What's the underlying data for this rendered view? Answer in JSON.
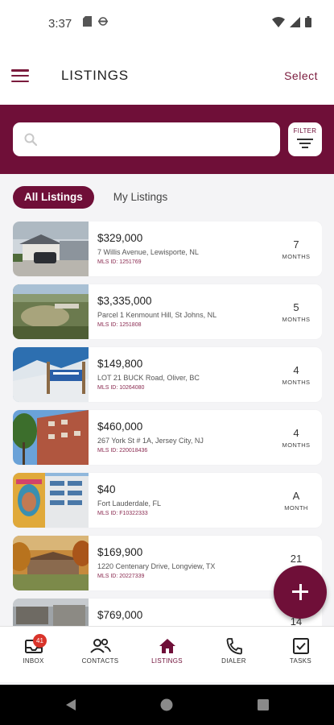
{
  "status_bar": {
    "time": "3:37"
  },
  "header": {
    "title": "LISTINGS",
    "select_label": "Select"
  },
  "search": {
    "placeholder": "",
    "value": "",
    "filter_label": "FILTER"
  },
  "tabs": [
    {
      "label": "All Listings",
      "active": true
    },
    {
      "label": "My Listings",
      "active": false
    }
  ],
  "listings": [
    {
      "price": "$329,000",
      "address": "7 Willis Avenue, Lewisporte, NL",
      "mls": "MLS ID: 1251769",
      "age_value": "7",
      "age_unit": "MONTHS"
    },
    {
      "price": "$3,335,000",
      "address": "Parcel 1 Kenmount Hill, St Johns, NL",
      "mls": "MLS ID: 1251808",
      "age_value": "5",
      "age_unit": "MONTHS"
    },
    {
      "price": "$149,800",
      "address": "LOT 21 BUCK Road, Oliver, BC",
      "mls": "MLS ID: 10264080",
      "age_value": "4",
      "age_unit": "MONTHS"
    },
    {
      "price": "$460,000",
      "address": "267 York St # 1A, Jersey City, NJ",
      "mls": "MLS ID: 220018436",
      "age_value": "4",
      "age_unit": "MONTHS"
    },
    {
      "price": "$40",
      "address": "Fort Lauderdale, FL",
      "mls": "MLS ID: F10322333",
      "age_value": "A",
      "age_unit": "MONTH"
    },
    {
      "price": "$169,900",
      "address": "1220 Centenary Drive, Longview, TX",
      "mls": "MLS ID: 20227339",
      "age_value": "21",
      "age_unit": ""
    },
    {
      "price": "$769,000",
      "address": "",
      "mls": "",
      "age_value": "14",
      "age_unit": ""
    }
  ],
  "bottom_nav": [
    {
      "label": "INBOX",
      "icon": "inbox-icon",
      "badge": "41"
    },
    {
      "label": "CONTACTS",
      "icon": "contacts-icon"
    },
    {
      "label": "LISTINGS",
      "icon": "home-icon",
      "active": true
    },
    {
      "label": "DIALER",
      "icon": "phone-icon"
    },
    {
      "label": "TASKS",
      "icon": "checkbox-icon"
    }
  ],
  "colors": {
    "brand": "#6f0f38",
    "badge": "#d9342b",
    "background": "#f4f4f6"
  }
}
